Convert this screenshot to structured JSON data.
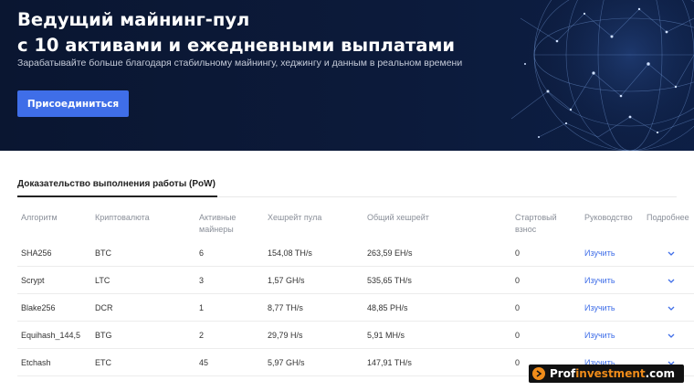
{
  "hero": {
    "title_line1": "Ведущий майнинг-пул",
    "title_line2": "с 10 активами и ежедневными выплатами",
    "subtitle": "Зарабатывайте больше благодаря стабильному майнингу, хеджингу и данным в реальном времени",
    "join_label": "Присоединиться"
  },
  "tabs": {
    "pow_label": "Доказательство выполнения работы (PoW)"
  },
  "table": {
    "headers": {
      "algorithm": "Алгоритм",
      "currency": "Криптовалюта",
      "miners_line1": "Активные",
      "miners_line2": "майнеры",
      "pool_hashrate": "Хешрейт пула",
      "total_hashrate": "Общий хешрейт",
      "fee_line1": "Стартовый",
      "fee_line2": "взнос",
      "guide": "Руководство",
      "more": "Подробнее"
    },
    "rows": [
      {
        "algorithm": "SHA256",
        "currency": "BTC",
        "miners": "6",
        "pool_hashrate": "154,08 TH/s",
        "total_hashrate": "263,59 EH/s",
        "fee": "0",
        "guide": "Изучить"
      },
      {
        "algorithm": "Scrypt",
        "currency": "LTC",
        "miners": "3",
        "pool_hashrate": "1,57 GH/s",
        "total_hashrate": "535,65 TH/s",
        "fee": "0",
        "guide": "Изучить"
      },
      {
        "algorithm": "Blake256",
        "currency": "DCR",
        "miners": "1",
        "pool_hashrate": "8,77 TH/s",
        "total_hashrate": "48,85 PH/s",
        "fee": "0",
        "guide": "Изучить"
      },
      {
        "algorithm": "Equihash_144,5",
        "currency": "BTG",
        "miners": "2",
        "pool_hashrate": "29,79 H/s",
        "total_hashrate": "5,91 MH/s",
        "fee": "0",
        "guide": "Изучить"
      },
      {
        "algorithm": "Etchash",
        "currency": "ETC",
        "miners": "45",
        "pool_hashrate": "5,97 GH/s",
        "total_hashrate": "147,91 TH/s",
        "fee": "0",
        "guide": "Изучить"
      }
    ]
  },
  "watermark": {
    "prefix": "Prof",
    "middle": "investment",
    "suffix": ".com"
  },
  "colors": {
    "hero_bg": "#0a1631",
    "accent": "#3f6ee8",
    "watermark_orange": "#f08c1a"
  },
  "icons": [
    "globe-network-graphic",
    "chevron-down-icon",
    "watermark-logo-icon"
  ]
}
